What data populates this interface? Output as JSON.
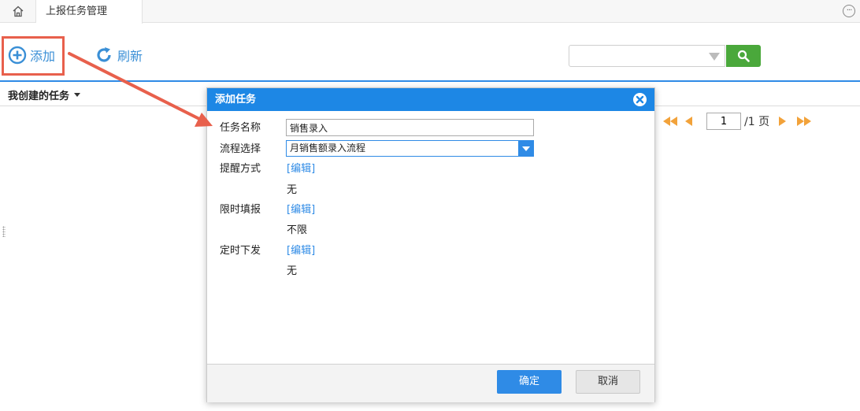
{
  "tabbar": {
    "home_icon": "home-icon",
    "page_tab_label": "上报任务管理",
    "menu_icon": "more-icon"
  },
  "toolbar": {
    "add_label": "添加",
    "add_icon": "plus-circle-icon",
    "refresh_label": "刷新",
    "refresh_icon": "refresh-icon",
    "search_value": "",
    "search_icon": "search-icon"
  },
  "list": {
    "title": "我创建的任务"
  },
  "pager": {
    "current_page": "1",
    "total_label": "/1 页"
  },
  "dialog": {
    "title": "添加任务",
    "fields": {
      "task_name_label": "任务名称",
      "task_name_value": "销售录入",
      "flow_label": "流程选择",
      "flow_value": "月销售额录入流程",
      "reminder_label": "提醒方式",
      "reminder_edit": "[编辑]",
      "reminder_value": "无",
      "deadline_label": "限时填报",
      "deadline_edit": "[编辑]",
      "deadline_value": "不限",
      "schedule_label": "定时下发",
      "schedule_edit": "[编辑]",
      "schedule_value": "无"
    },
    "ok_label": "确定",
    "cancel_label": "取消"
  },
  "colors": {
    "accent": "#2f8be6",
    "search_button": "#4aa83b",
    "pager_arrows": "#f2a23a",
    "annotation": "#e8604c"
  }
}
